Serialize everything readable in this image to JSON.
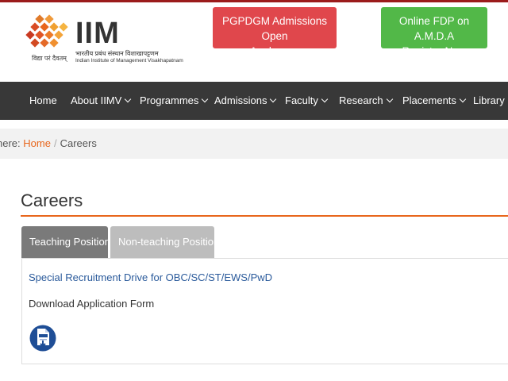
{
  "header": {
    "logo_text": "IIM",
    "logo_hindi": "भारतीय प्रबंध संस्थान विशाखापट्टणम",
    "logo_english": "Indian Institute of Management Visakhapatnam",
    "logo_motto": "विद्या परं दैवतम्",
    "pg_button": {
      "line1": "PGPDGM Admissions Open",
      "line2": "Apply now"
    },
    "fdp_button": {
      "line1": "Online FDP on A.M.D.A",
      "line2": "Register Now"
    }
  },
  "nav": {
    "items": [
      {
        "label": "Home"
      },
      {
        "label": "About IIMV"
      },
      {
        "label": "Programmes"
      },
      {
        "label": "Admissions"
      },
      {
        "label": "Faculty"
      },
      {
        "label": "Research"
      },
      {
        "label": "Placements"
      },
      {
        "label": "Library"
      }
    ]
  },
  "breadcrumb": {
    "prefix": "here:",
    "home": "Home",
    "separator": "/",
    "current": "Careers"
  },
  "main": {
    "title": "Careers",
    "tabs": [
      {
        "label": "Teaching Positions"
      },
      {
        "label": "Non-teaching Positions"
      }
    ],
    "link": "Special Recruitment Drive for OBC/SC/ST/EWS/PwD",
    "download_label": "Download Application Form"
  },
  "colors": {
    "accent_orange": "#e8661c",
    "nav_bg": "#383838",
    "pg_button": "#e0474c",
    "fdp_button": "#52b848",
    "link": "#2a5a9b"
  },
  "icons": {
    "logo": "iim-logo-icon",
    "download": "pdf-download-icon",
    "caret": "chevron-down-icon"
  }
}
